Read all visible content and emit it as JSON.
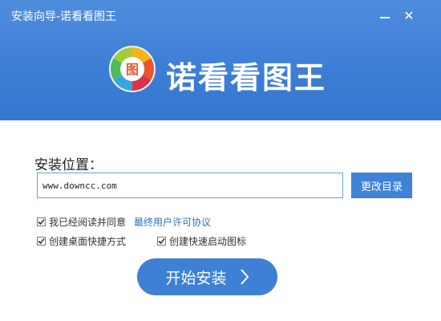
{
  "window": {
    "title": "安装向导-诺看看图王",
    "minimize_icon": "minimize-icon",
    "close_icon": "close-icon",
    "close_glyph": "✕"
  },
  "brand": {
    "name": "诺看看图王",
    "logo_icon": "app-logo-icon",
    "logo_glyph": "图"
  },
  "install": {
    "location_label": "安装位置：",
    "path_value": "www.downcc.com",
    "change_dir_label": "更改目录",
    "agree_label": "我已经阅读并同意",
    "agree_checked": true,
    "license_link": "最终用户许可协议",
    "desktop_shortcut_label": "创建桌面快捷方式",
    "desktop_shortcut_checked": true,
    "quicklaunch_label": "创建快速启动图标",
    "quicklaunch_checked": true,
    "start_button_label": "开始安装",
    "start_button_icon": "chevron-right-icon"
  },
  "colors": {
    "header_blue": "#3e7fd6",
    "button_blue": "#3f82d6",
    "link_blue": "#2f6fc6",
    "input_border": "#6aa1df"
  }
}
